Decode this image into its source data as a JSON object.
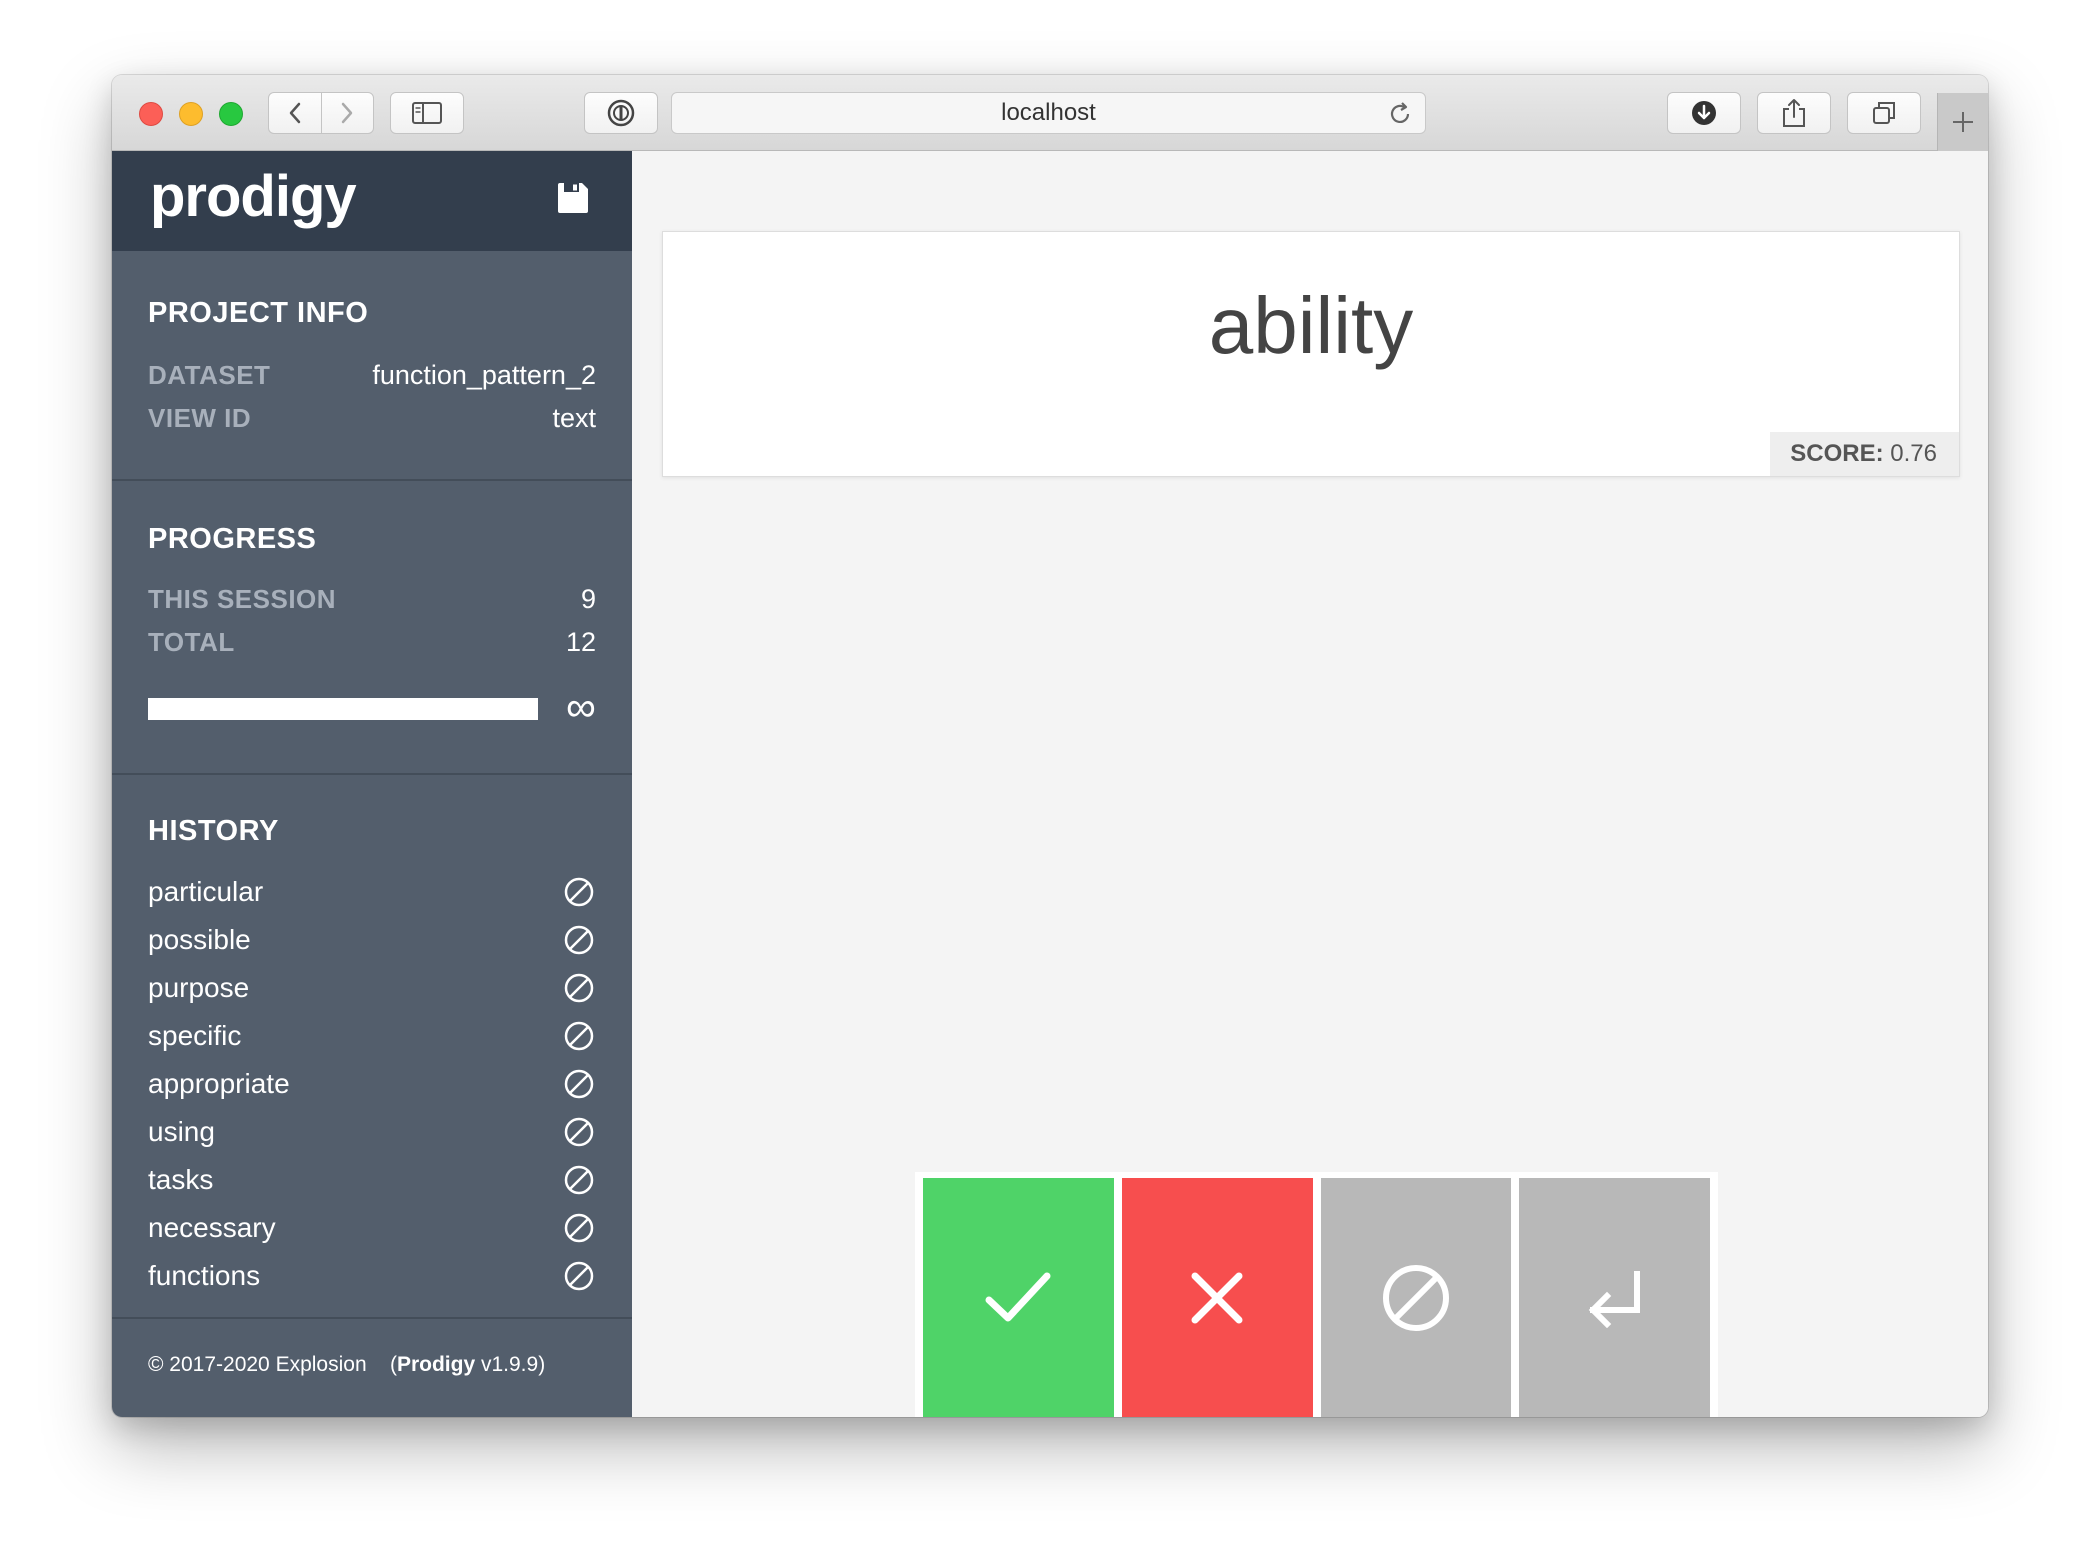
{
  "browser": {
    "url": "localhost",
    "traffic_lights": [
      "close",
      "minimize",
      "zoom"
    ]
  },
  "sidebar": {
    "logo": "prodigy",
    "project_info": {
      "title": "PROJECT INFO",
      "dataset_label": "DATASET",
      "dataset_value": "function_pattern_2",
      "view_id_label": "VIEW ID",
      "view_id_value": "text"
    },
    "progress": {
      "title": "PROGRESS",
      "session_label": "THIS SESSION",
      "session_value": "9",
      "total_label": "TOTAL",
      "total_value": "12",
      "bar_fraction": 1.0,
      "infinity_symbol": "∞"
    },
    "history": {
      "title": "HISTORY",
      "items": [
        {
          "label": "particular",
          "status": "ignore"
        },
        {
          "label": "possible",
          "status": "ignore"
        },
        {
          "label": "purpose",
          "status": "ignore"
        },
        {
          "label": "specific",
          "status": "ignore"
        },
        {
          "label": "appropriate",
          "status": "ignore"
        },
        {
          "label": "using",
          "status": "ignore"
        },
        {
          "label": "tasks",
          "status": "ignore"
        },
        {
          "label": "necessary",
          "status": "ignore"
        },
        {
          "label": "functions",
          "status": "ignore"
        }
      ]
    },
    "footer": {
      "copyright": "© 2017-2020 Explosion",
      "paren_open": "(",
      "product": "Prodigy",
      "version": " v1.9.9)"
    }
  },
  "main": {
    "task_text": "ability",
    "score_label": "SCORE:",
    "score_value": "0.76"
  },
  "actions": [
    {
      "name": "accept",
      "icon": "check-icon",
      "color": "#4fd368"
    },
    {
      "name": "reject",
      "icon": "x-icon",
      "color": "#f74e4e"
    },
    {
      "name": "ignore",
      "icon": "ignore-icon",
      "color": "#b8b8b8"
    },
    {
      "name": "undo",
      "icon": "undo-icon",
      "color": "#b8b8b8"
    }
  ],
  "colors": {
    "sidebar_bg": "#535e6c",
    "sidebar_header_bg": "#333e4d",
    "main_bg": "#f4f4f4",
    "accept": "#4fd368",
    "reject": "#f74e4e",
    "neutral": "#b8b8b8"
  }
}
